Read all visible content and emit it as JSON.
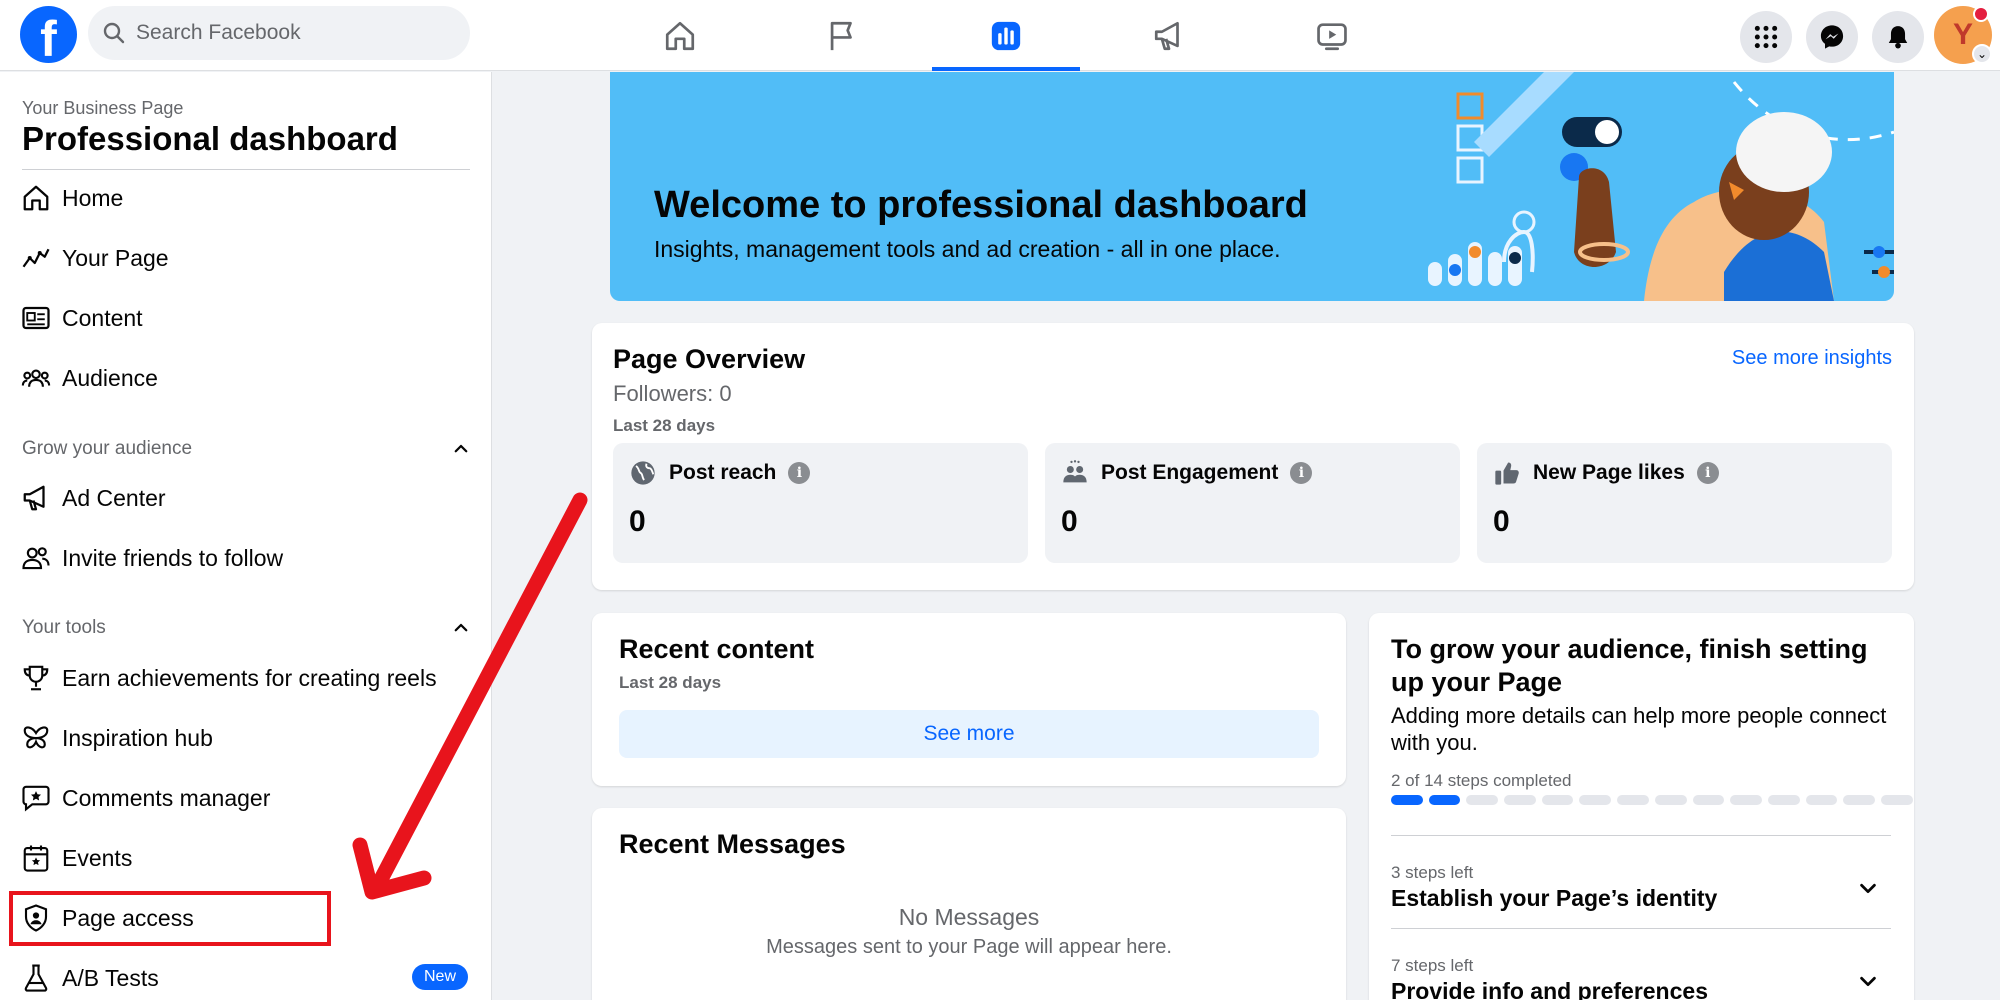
{
  "topbar": {
    "logo": "f",
    "search_placeholder": "Search Facebook",
    "nav_tabs": [
      {
        "name": "home-icon",
        "active": false
      },
      {
        "name": "flag-icon",
        "active": false
      },
      {
        "name": "dashboard-icon",
        "active": true
      },
      {
        "name": "megaphone-icon",
        "active": false
      },
      {
        "name": "video-icon",
        "active": false
      }
    ],
    "right_buttons": [
      "menu-grid-icon",
      "messenger-icon",
      "bell-icon"
    ],
    "avatar_letter": "Y",
    "accent_color": "#0866ff"
  },
  "sidebar": {
    "subtitle": "Your Business Page",
    "title": "Professional dashboard",
    "items_main": [
      {
        "label": "Home",
        "icon": "home-icon"
      },
      {
        "label": "Your Page",
        "icon": "trend-icon"
      },
      {
        "label": "Content",
        "icon": "content-icon"
      },
      {
        "label": "Audience",
        "icon": "audience-icon"
      }
    ],
    "section_grow": "Grow your audience",
    "items_grow": [
      {
        "label": "Ad Center",
        "icon": "megaphone-icon"
      },
      {
        "label": "Invite friends to follow",
        "icon": "people-icon"
      }
    ],
    "section_tools": "Your tools",
    "items_tools": [
      {
        "label": "Earn achievements for creating reels",
        "icon": "trophy-icon"
      },
      {
        "label": "Inspiration hub",
        "icon": "butterfly-icon"
      },
      {
        "label": "Comments manager",
        "icon": "comment-star-icon"
      },
      {
        "label": "Events",
        "icon": "calendar-star-icon"
      },
      {
        "label": "Page access",
        "icon": "shield-person-icon"
      },
      {
        "label": "A/B Tests",
        "icon": "flask-icon"
      }
    ],
    "new_badge": "New",
    "highlight_color": "#e8141c"
  },
  "banner": {
    "title": "Welcome to professional dashboard",
    "subtitle": "Insights, management tools and ad creation - all in one place.",
    "bg_color": "#51bdf7"
  },
  "overview": {
    "title": "Page Overview",
    "followers": "Followers: 0",
    "period": "Last 28 days",
    "link": "See more insights",
    "stats": [
      {
        "label": "Post reach",
        "value": "0",
        "icon": "globe-icon"
      },
      {
        "label": "Post Engagement",
        "value": "0",
        "icon": "engagement-icon"
      },
      {
        "label": "New Page likes",
        "value": "0",
        "icon": "thumbs-up-icon"
      }
    ]
  },
  "recent_content": {
    "title": "Recent content",
    "period": "Last 28 days",
    "button": "See more"
  },
  "recent_messages": {
    "title": "Recent Messages",
    "empty_title": "No Messages",
    "empty_text": "Messages sent to your Page will appear here."
  },
  "setup": {
    "title": "To grow your audience, finish setting up your Page",
    "text": "Adding more details can help more people connect with you.",
    "progress_text": "2 of 14 steps completed",
    "steps_done": 2,
    "steps_total": 14,
    "accordion": [
      {
        "steps": "3 steps left",
        "title": "Establish your Page’s identity"
      },
      {
        "steps": "7 steps left",
        "title": "Provide info and preferences"
      }
    ]
  }
}
